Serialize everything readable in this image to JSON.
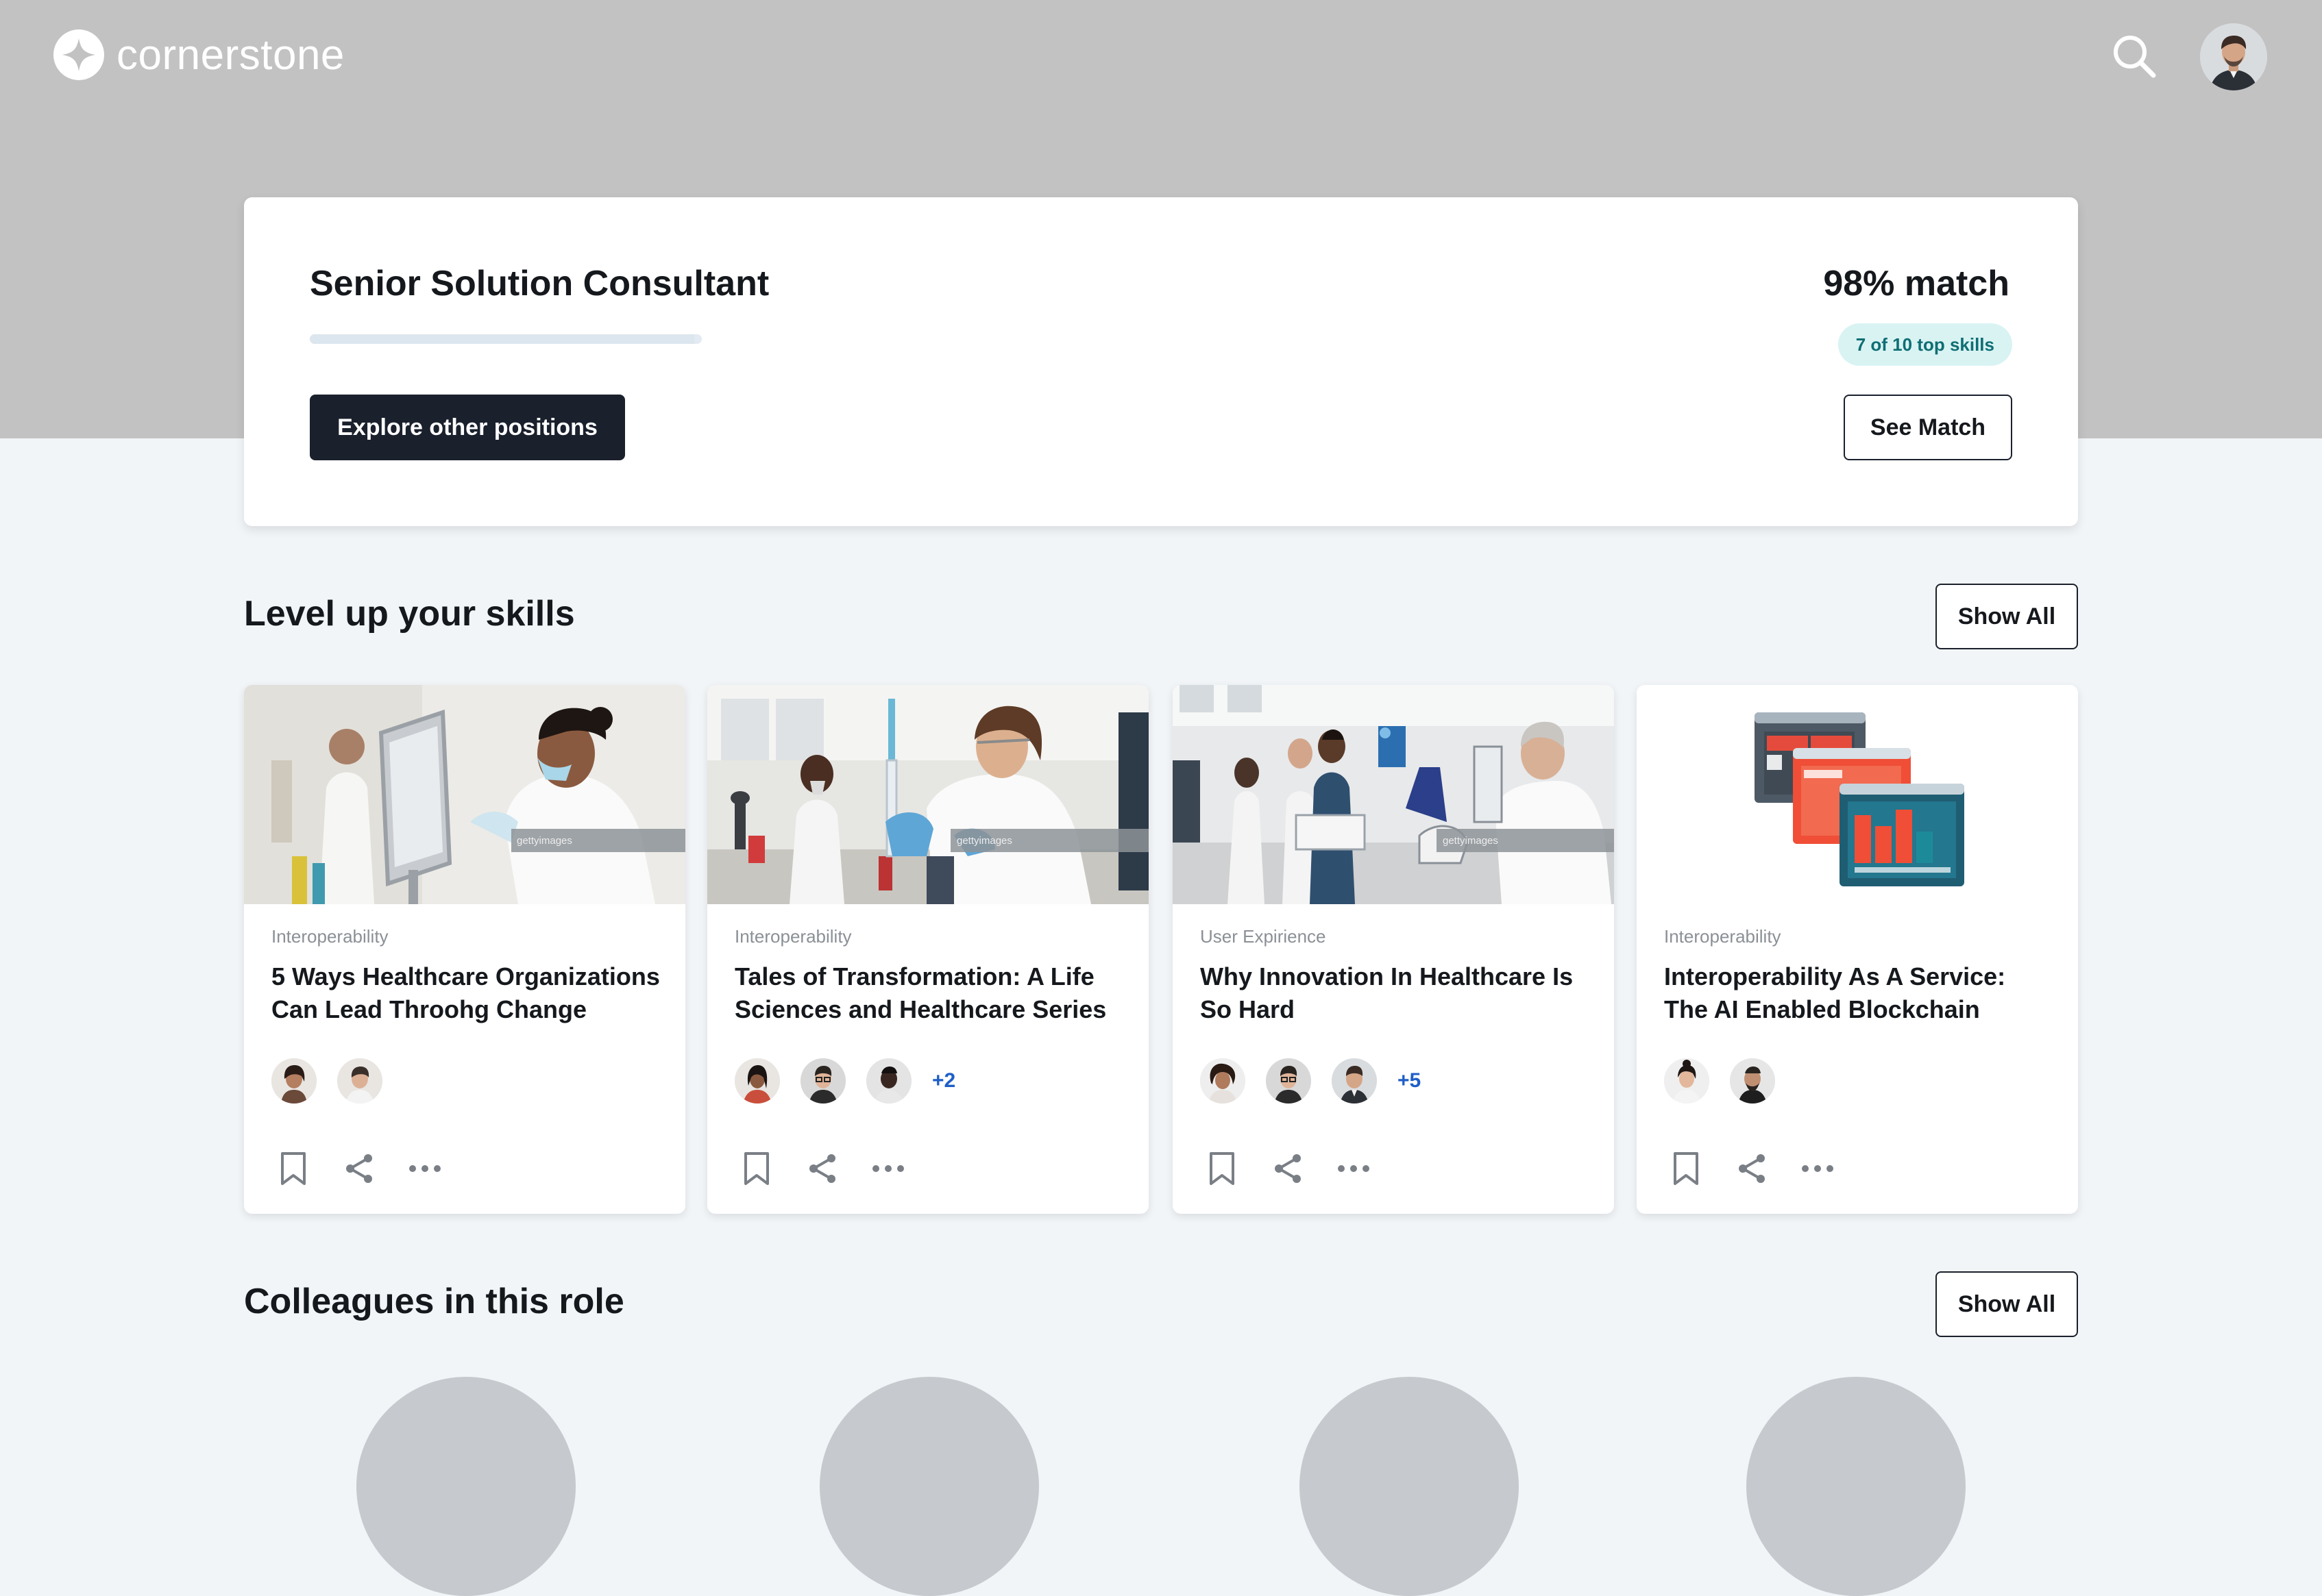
{
  "header": {
    "logo_text": "cornerstone",
    "logo_icon": "cornerstone-star-icon",
    "search_icon": "search-icon",
    "avatar_icon": "user-avatar"
  },
  "role": {
    "title": "Senior Solution Consultant",
    "match": "98% match",
    "skills_badge": "7 of 10 top skills",
    "progress": 0.98,
    "explore_button": "Explore other positions",
    "see_match_button": "See Match"
  },
  "skills_section": {
    "title": "Level up your skills",
    "show_all": "Show All",
    "cards": [
      {
        "category": "Interoperability",
        "title": "5 Ways Healthcare Organizations Can Lead Throohg Change",
        "extra": ""
      },
      {
        "category": "Interoperability",
        "title": "Tales of Transformation: A Life Sciences and Healthcare Series",
        "extra": "+2"
      },
      {
        "category": "User Expirience",
        "title": "Why Innovation In Healthcare Is So Hard",
        "extra": "+5"
      },
      {
        "category": "Interoperability",
        "title": "Interoperability As A Service: The AI Enabled Blockchain",
        "extra": ""
      }
    ]
  },
  "colleagues_section": {
    "title": "Colleagues in this role",
    "show_all": "Show All"
  },
  "colors": {
    "hero": "#c2c2c2",
    "background": "#f2f5f8",
    "primary_button": "#1a202c",
    "badge_bg": "#d9f3f3",
    "badge_text": "#0f6e73",
    "extra_count": "#1f5fc7"
  }
}
